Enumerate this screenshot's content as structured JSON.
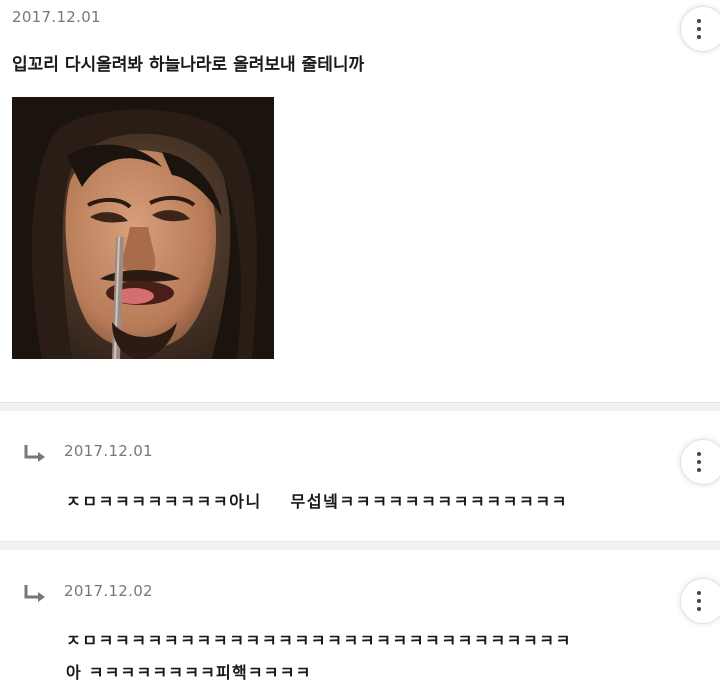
{
  "post": {
    "date": "2017.12.01",
    "text": "입꼬리 다시올려봐 하늘나라로 올려보내 줄테니까",
    "more_icon": "more-vertical-icon"
  },
  "replies": [
    {
      "date": "2017.12.01",
      "lines": [
        "ㅈㅁㅋㅋㅋㅋㅋㅋㅋㅋ아니    무섭넼ㅋㅋㅋㅋㅋㅋㅋㅋㅋㅋㅋㅋㅋㅋ"
      ],
      "reply_icon": "reply-arrow-icon",
      "more_icon": "more-vertical-icon"
    },
    {
      "date": "2017.12.02",
      "lines": [
        "ㅈㅁㅋㅋㅋㅋㅋㅋㅋㅋㅋㅋㅋㅋㅋㅋㅋㅋㅋㅋㅋㅋㅋㅋㅋㅋㅋㅋㅋㅋㅋ",
        "아 ㅋㅋㅋㅋㅋㅋㅋㅋ피핵ㅋㅋㅋㅋ"
      ],
      "reply_icon": "reply-arrow-icon",
      "more_icon": "more-vertical-icon"
    }
  ],
  "colors": {
    "background": "#ffffff",
    "divider": "#f2f2f2",
    "date_text": "#777777",
    "body_text": "#1a1a1a"
  }
}
